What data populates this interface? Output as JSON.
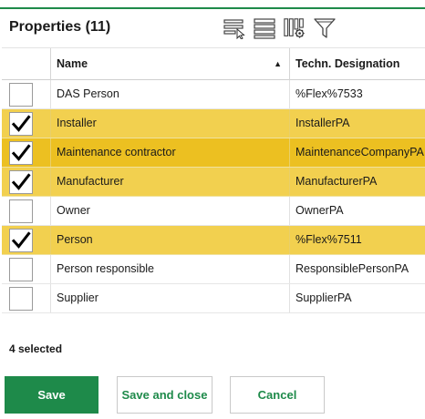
{
  "panel": {
    "title": "Properties (11)"
  },
  "toolbar": {
    "icons": [
      "select-rows-icon",
      "list-view-icon",
      "column-settings-icon",
      "filter-icon"
    ]
  },
  "table": {
    "columns": {
      "name": "Name",
      "tech": "Techn. Designation",
      "sort_indicator": "▲"
    },
    "rows": [
      {
        "name": "DAS Person",
        "tech": "%Flex%7533",
        "checked": false
      },
      {
        "name": "Installer",
        "tech": "InstallerPA",
        "checked": true
      },
      {
        "name": "Maintenance contractor",
        "tech": "MaintenanceCompanyPA",
        "checked": true
      },
      {
        "name": "Manufacturer",
        "tech": "ManufacturerPA",
        "checked": true
      },
      {
        "name": "Owner",
        "tech": "OwnerPA",
        "checked": false
      },
      {
        "name": "Person",
        "tech": "%Flex%7511",
        "checked": true
      },
      {
        "name": "Person responsible",
        "tech": "ResponsiblePersonPA",
        "checked": false
      },
      {
        "name": "Supplier",
        "tech": "SupplierPA",
        "checked": false
      }
    ]
  },
  "status": {
    "selected_text": "4 selected"
  },
  "buttons": {
    "save": "Save",
    "save_close": "Save and close",
    "cancel": "Cancel"
  },
  "colors": {
    "accent": "#1e8a4a",
    "selected_row": "#f2d04f",
    "active_row": "#ecc021"
  }
}
